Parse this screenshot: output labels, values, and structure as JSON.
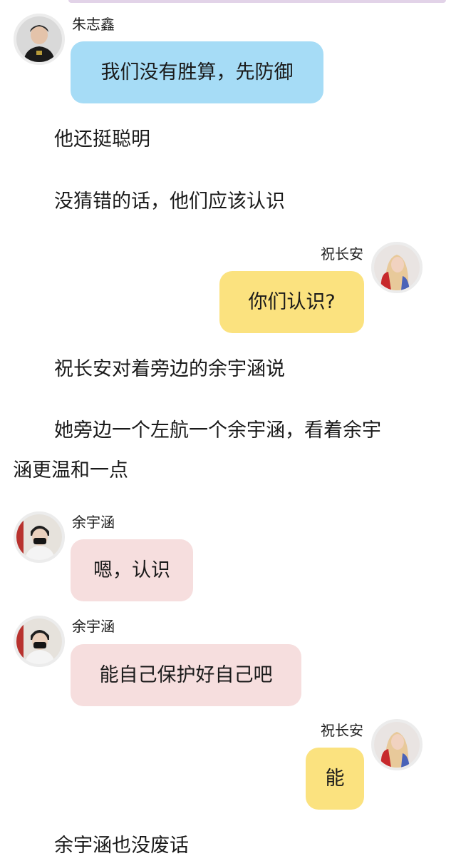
{
  "messages": [
    {
      "speaker": "朱志鑫",
      "text": "我们没有胜算，先防御"
    },
    {
      "speaker": "祝长安",
      "text": "你们认识?"
    },
    {
      "speaker": "余宇涵",
      "text": "嗯，认识"
    },
    {
      "speaker": "余宇涵",
      "text": "能自己保护好自己吧"
    },
    {
      "speaker": "祝长安",
      "text": "能"
    }
  ],
  "narration": {
    "line1": "他还挺聪明",
    "line2": "没猜错的话，他们应该认识",
    "line3": "祝长安对着旁边的余宇涵说",
    "line4a": "她旁边一个左航一个余宇涵，看着余宇",
    "line4b": "涵更温和一点",
    "line5": "余宇涵也没废话"
  },
  "avatar_icons": {
    "zhu_zhixin": "boy-avatar-icon",
    "zhu_changan": "girl-avatar-icon",
    "yu_yuhan": "masked-boy-avatar-icon"
  },
  "colors": {
    "bubble_blue": "#a6dcf6",
    "bubble_yellow": "#fbe27f",
    "bubble_pink": "#f6dede"
  }
}
